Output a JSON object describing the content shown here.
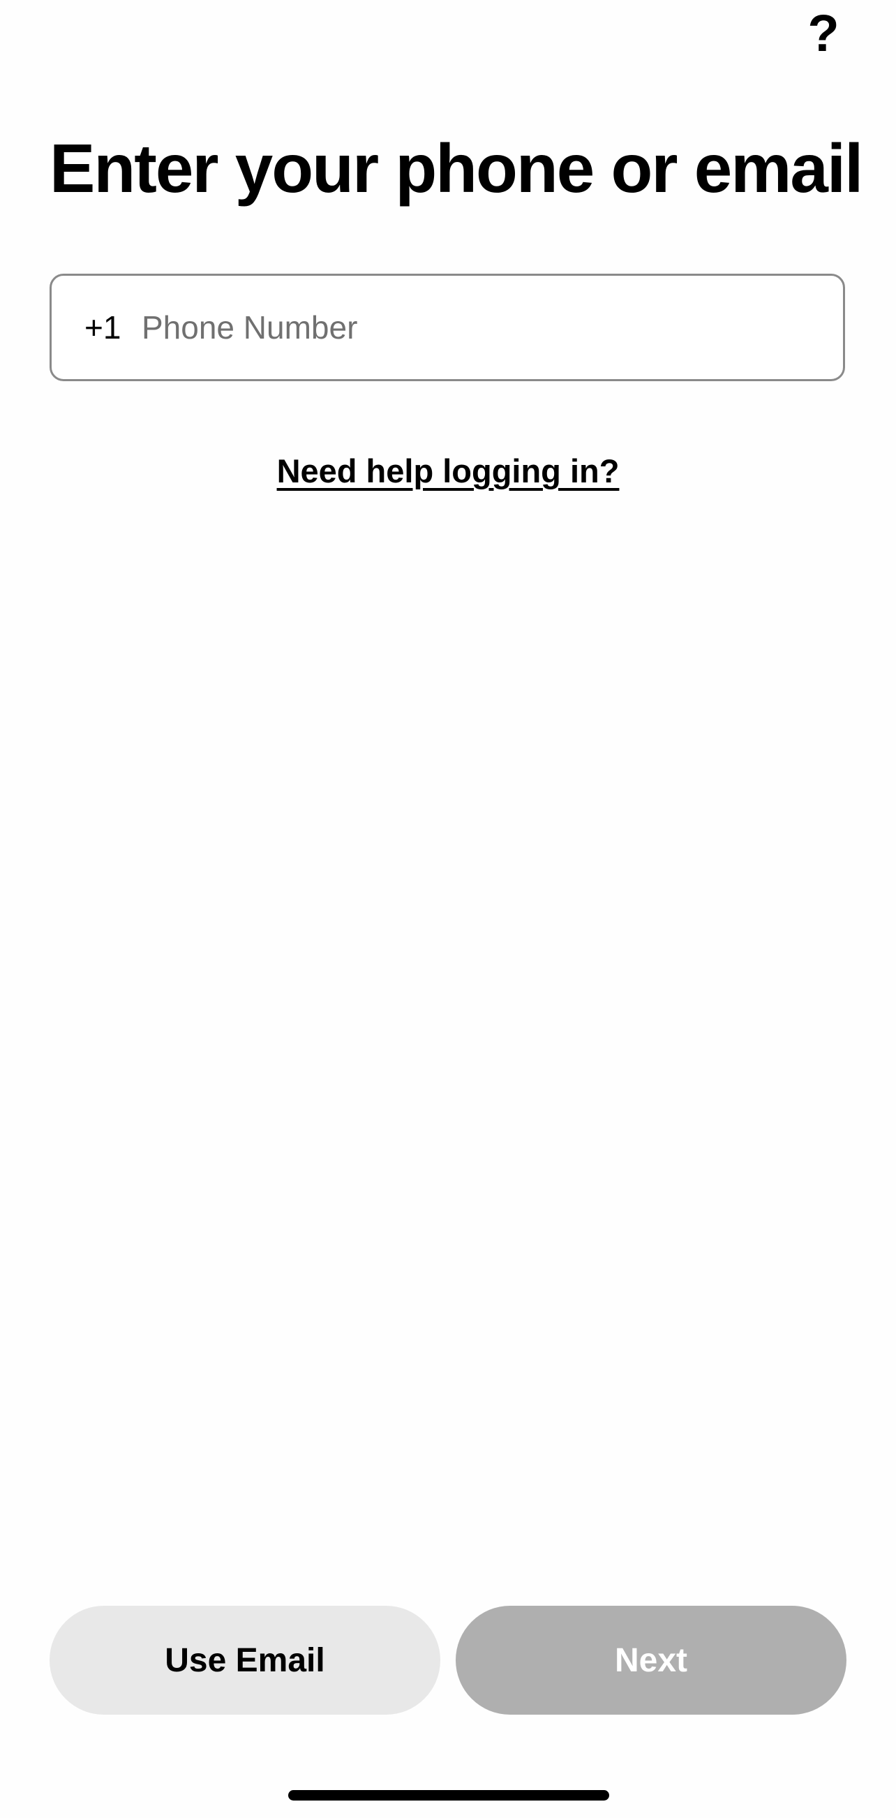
{
  "header": {
    "help_icon": "?",
    "help_icon_name": "question-mark-icon"
  },
  "page": {
    "title": "Enter your phone or email"
  },
  "phone_field": {
    "country_code": "+1",
    "value": "",
    "placeholder": "Phone Number"
  },
  "links": {
    "help_login": "Need help logging in?"
  },
  "actions": {
    "use_email_label": "Use Email",
    "next_label": "Next",
    "next_enabled": false
  },
  "colors": {
    "background": "#fefefe",
    "text": "#000000",
    "field_border": "#8a8a8a",
    "placeholder": "#707070",
    "secondary_button": "#e8e8e8",
    "disabled_button": "#afafaf",
    "disabled_button_text": "#ffffff"
  }
}
